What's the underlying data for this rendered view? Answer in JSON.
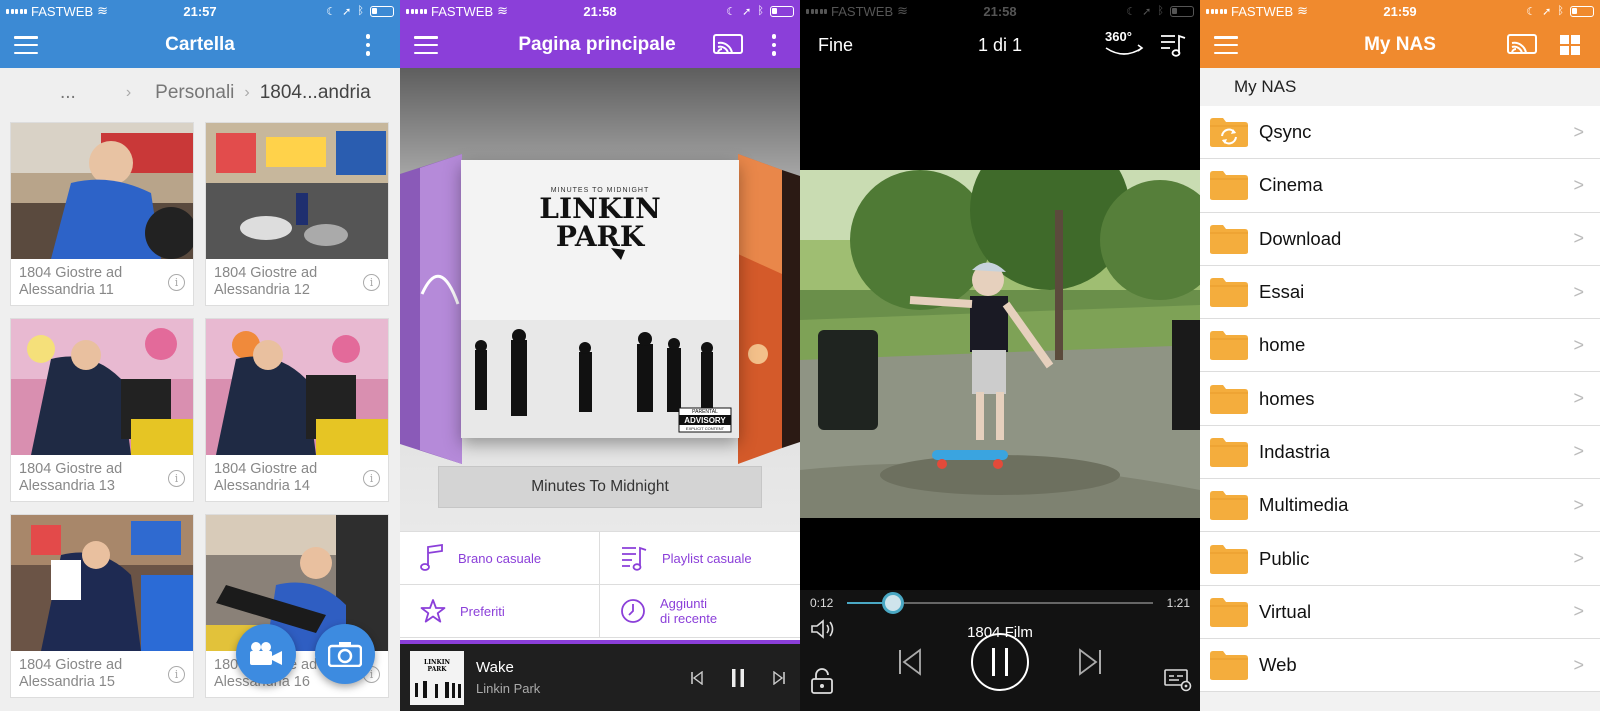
{
  "status_bars": [
    {
      "carrier": "FASTWEB",
      "time": "21:57"
    },
    {
      "carrier": "FASTWEB",
      "time": "21:58"
    },
    {
      "carrier": "FASTWEB",
      "time": "21:58"
    },
    {
      "carrier": "FASTWEB",
      "time": "21:59"
    }
  ],
  "photos": {
    "title": "Cartella",
    "breadcrumb": [
      "...",
      "Personali",
      "1804...andria"
    ],
    "tiles": [
      {
        "line1": "1804 Giostre ad",
        "line2": "Alessandria 11"
      },
      {
        "line1": "1804 Giostre ad",
        "line2": "Alessandria 12"
      },
      {
        "line1": "1804 Giostre ad",
        "line2": "Alessandria 13"
      },
      {
        "line1": "1804 Giostre ad",
        "line2": "Alessandria 14"
      },
      {
        "line1": "1804 Giostre ad",
        "line2": "Alessandria 15"
      },
      {
        "line1": "1804 Giostre ad",
        "line2": "Alessandria 16"
      }
    ],
    "colors": {
      "accent": "#3c8ad4"
    }
  },
  "music": {
    "title": "Pagina principale",
    "album": {
      "name": "Minutes To Midnight",
      "cover_small": "MINUTES TO MIDNIGHT",
      "cover_band_1": "LINKIN",
      "cover_band_2": "PARK",
      "advisory_1": "PARENTAL",
      "advisory_2": "ADVISORY",
      "advisory_3": "EXPLICIT CONTENT"
    },
    "shortcuts": [
      {
        "label": "Brano casuale",
        "icon": "music-note-icon"
      },
      {
        "label": "Playlist casuale",
        "icon": "playlist-icon"
      },
      {
        "label": "Preferiti",
        "icon": "star-icon"
      },
      {
        "label": "Aggiunti",
        "label2": "di recente",
        "icon": "clock-icon"
      }
    ],
    "now_playing": {
      "song": "Wake",
      "artist": "Linkin Park",
      "art_1": "LINKIN",
      "art_2": "PARK"
    },
    "colors": {
      "accent": "#8b3fd9"
    }
  },
  "video": {
    "done": "Fine",
    "counter": "1 di 1",
    "badge": "360°",
    "elapsed": "0:12",
    "duration": "1:21",
    "progress": 0.148,
    "title": "1804 Film",
    "colors": {
      "accent": "#4aa8c4"
    }
  },
  "nas": {
    "title": "My NAS",
    "section": "My NAS",
    "folders": [
      "Qsync",
      "Cinema",
      "Download",
      "Essai",
      "home",
      "homes",
      "Indastria",
      "Multimedia",
      "Public",
      "Virtual",
      "Web"
    ],
    "colors": {
      "accent": "#f08a2e",
      "folder": "#f4ad3d"
    }
  }
}
